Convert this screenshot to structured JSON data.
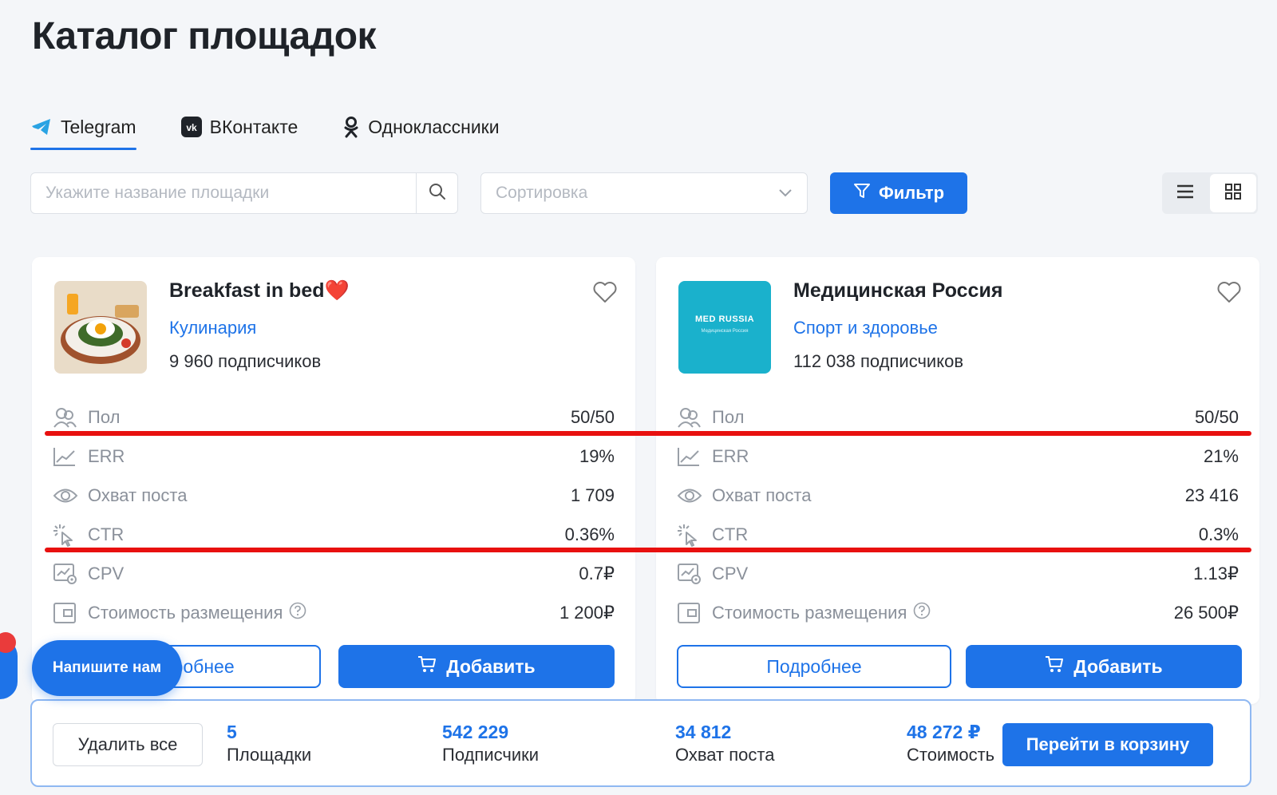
{
  "page": {
    "title": "Каталог площадок"
  },
  "tabs": [
    {
      "label": "Telegram",
      "icon": "telegram-icon",
      "active": true
    },
    {
      "label": "ВКонтакте",
      "icon": "vk-icon",
      "active": false
    },
    {
      "label": "Одноклассники",
      "icon": "ok-icon",
      "active": false
    }
  ],
  "search": {
    "placeholder": "Укажите название площадки"
  },
  "sort": {
    "placeholder": "Сортировка"
  },
  "filter": {
    "label": "Фильтр"
  },
  "colors": {
    "accent": "#1e73e8",
    "highlight": "#e8100f"
  },
  "cards": [
    {
      "name": "Breakfast in bed❤️",
      "category": "Кулинария",
      "subscribers": "9 960 подписчиков",
      "metrics": [
        {
          "label": "Пол",
          "value": "50/50",
          "icon": "gender-icon"
        },
        {
          "label": "ERR",
          "value": "19%",
          "icon": "chart-line-icon"
        },
        {
          "label": "Охват поста",
          "value": "1 709",
          "icon": "eye-icon"
        },
        {
          "label": "CTR",
          "value": "0.36%",
          "icon": "cursor-click-icon"
        },
        {
          "label": "CPV",
          "value": "0.7₽",
          "icon": "views-chart-icon"
        },
        {
          "label": "Стоимость размещения",
          "value": "1 200₽",
          "icon": "wallet-icon"
        }
      ],
      "more_label": "Подробнее",
      "add_label": "Добавить"
    },
    {
      "name": "Медицинская Россия",
      "category": "Спорт и здоровье",
      "subscribers": "112 038 подписчиков",
      "logo_text": "MED RUSSIA",
      "logo_sub": "Медицинская Россия",
      "metrics": [
        {
          "label": "Пол",
          "value": "50/50",
          "icon": "gender-icon"
        },
        {
          "label": "ERR",
          "value": "21%",
          "icon": "chart-line-icon"
        },
        {
          "label": "Охват поста",
          "value": "23 416",
          "icon": "eye-icon"
        },
        {
          "label": "CTR",
          "value": "0.3%",
          "icon": "cursor-click-icon"
        },
        {
          "label": "CPV",
          "value": "1.13₽",
          "icon": "views-chart-icon"
        },
        {
          "label": "Стоимость размещения",
          "value": "26 500₽",
          "icon": "wallet-icon"
        }
      ],
      "more_label": "Подробнее",
      "add_label": "Добавить"
    }
  ],
  "cart_bar": {
    "delete_label": "Удалить все",
    "stats": [
      {
        "value": "5",
        "label": "Площадки"
      },
      {
        "value": "542 229",
        "label": "Подписчики"
      },
      {
        "value": "34 812",
        "label": "Охват поста"
      },
      {
        "value": "48 272 ₽",
        "label": "Стоимость"
      }
    ],
    "cart_label": "Перейти в корзину"
  },
  "chat": {
    "label": "Напишите нам"
  }
}
